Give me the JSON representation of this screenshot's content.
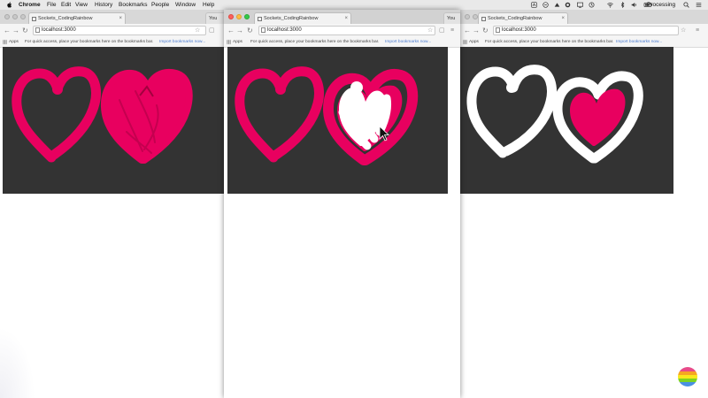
{
  "menubar": {
    "app_name": "Chrome",
    "menus": [
      "File",
      "Edit",
      "View",
      "History",
      "Bookmarks",
      "People",
      "Window",
      "Help"
    ],
    "processing_label": "Processing"
  },
  "windows": [
    {
      "tab_title": "Sockets_CodingRainbow",
      "second_tab_title": "You",
      "url": "localhost:3000",
      "bookmarks_apps": "Apps",
      "bookmarks_hint": "For quick access, place your bookmarks here on the bookmarks bar.",
      "bookmarks_link": "Import bookmarks now..."
    },
    {
      "tab_title": "Sockets_CodingRainbow",
      "second_tab_title": "You",
      "url": "localhost:3000",
      "bookmarks_apps": "Apps",
      "bookmarks_hint": "For quick access, place your bookmarks here on the bookmarks bar.",
      "bookmarks_link": "Import bookmarks now..."
    },
    {
      "tab_title": "Sockets_CodingRainbow",
      "url": "localhost:3000",
      "bookmarks_apps": "Apps",
      "bookmarks_hint": "For quick access, place your bookmarks here on the bookmarks bar.",
      "bookmarks_link": "Import bookmarks now..."
    }
  ],
  "colors": {
    "canvas_bg": "#333333",
    "pink": "#e8005f",
    "white": "#ffffff"
  },
  "icons": [
    "apple-icon",
    "back-icon",
    "forward-icon",
    "reload-icon",
    "star-icon",
    "menu-icon",
    "wifi-icon",
    "battery-icon",
    "volume-icon",
    "search-icon",
    "list-icon",
    "cursor-icon",
    "coding-rainbow-logo-icon"
  ]
}
